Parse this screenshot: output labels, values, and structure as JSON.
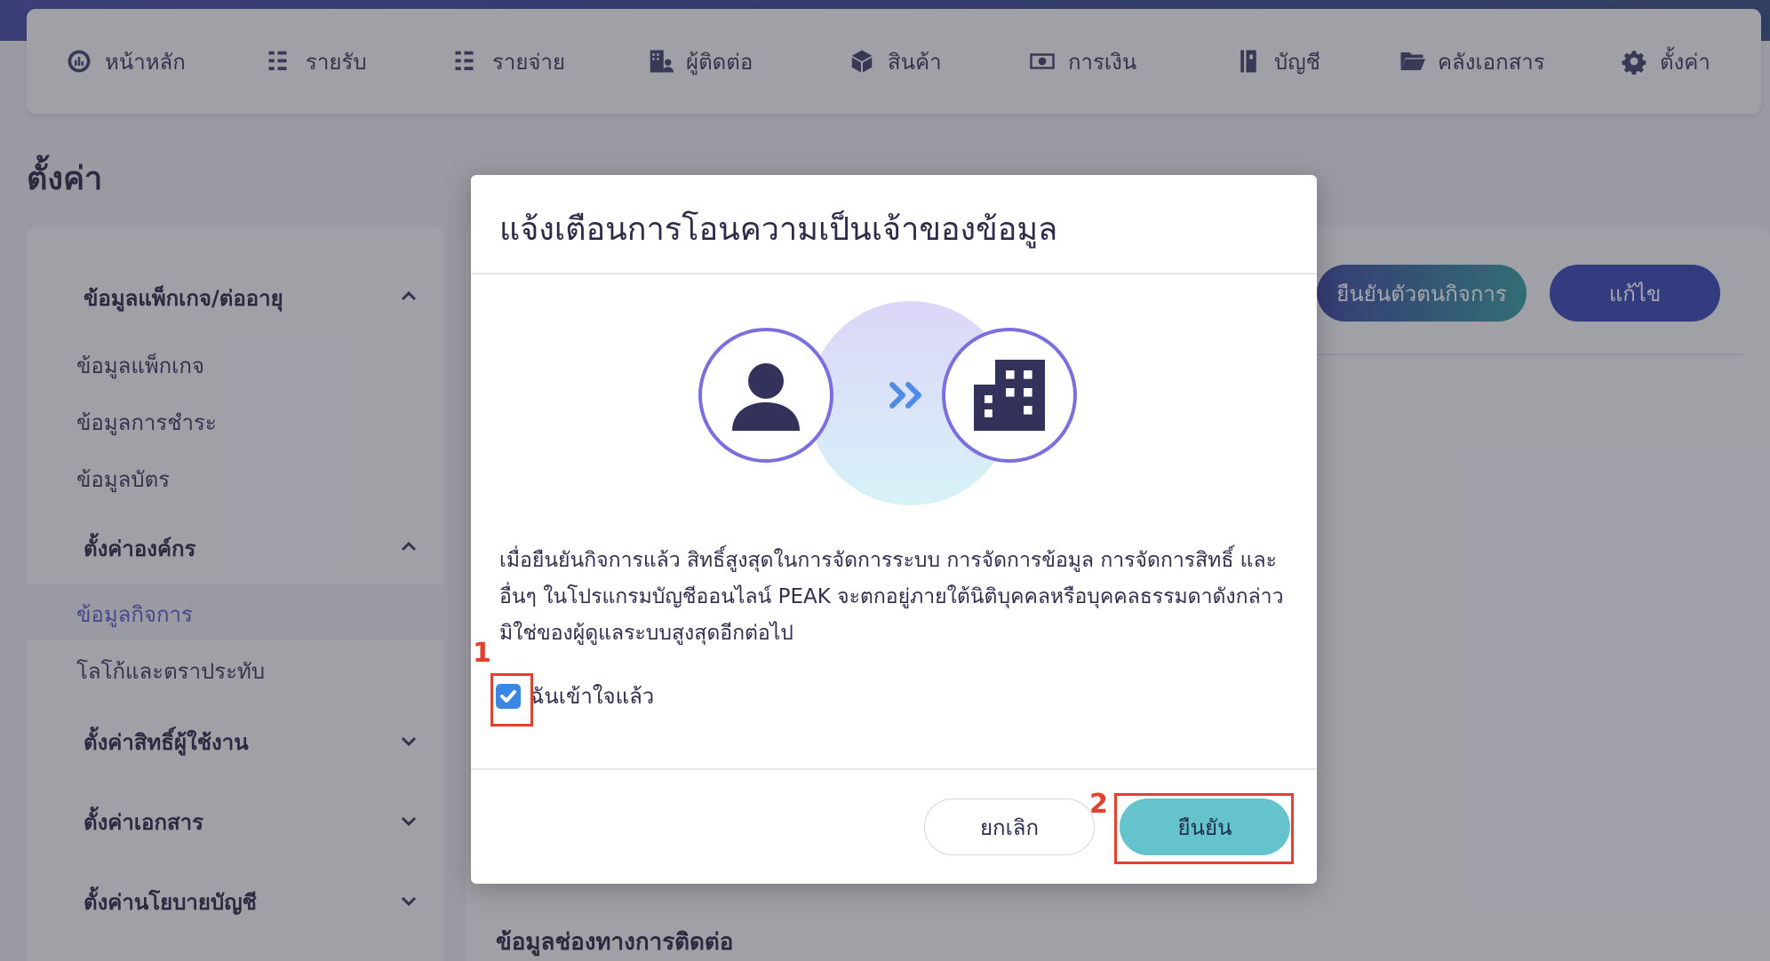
{
  "nav": {
    "items": [
      {
        "label": "หน้าหลัก",
        "icon": "dashboard-icon"
      },
      {
        "label": "รายรับ",
        "icon": "income-icon"
      },
      {
        "label": "รายจ่าย",
        "icon": "expense-icon"
      },
      {
        "label": "ผู้ติดต่อ",
        "icon": "contacts-icon"
      },
      {
        "label": "สินค้า",
        "icon": "box-icon"
      },
      {
        "label": "การเงิน",
        "icon": "money-icon"
      },
      {
        "label": "บัญชี",
        "icon": "book-icon"
      },
      {
        "label": "คลังเอกสาร",
        "icon": "folder-icon"
      },
      {
        "label": "ตั้งค่า",
        "icon": "gear-icon"
      }
    ]
  },
  "page": {
    "title": "ตั้งค่า"
  },
  "sidebar": {
    "group1": "ข้อมูลแพ็กเกจ/ต่ออายุ",
    "group1_items": [
      "ข้อมูลแพ็กเกจ",
      "ข้อมูลการชำระ",
      "ข้อมูลบัตร"
    ],
    "group2": "ตั้งค่าองค์กร",
    "group2_items": [
      "ข้อมูลกิจการ",
      "โลโก้และตราประทับ"
    ],
    "group3": "ตั้งค่าสิทธิ์ผู้ใช้งาน",
    "group4": "ตั้งค่าเอกสาร",
    "group5": "ตั้งค่านโยบายบัญชี"
  },
  "main": {
    "verify_button": "ยืนยันตัวตนกิจการ",
    "edit_button": "แก้ไข",
    "contact_section_title": "ข้อมูลช่องทางการติดต่อ"
  },
  "modal": {
    "title": "แจ้งเตือนการโอนความเป็นเจ้าของข้อมูล",
    "body_line1": "เมื่อยืนยันกิจการแล้ว สิทธิ์สูงสุดในการจัดการระบบ การจัดการข้อมูล การจัดการสิทธิ์ และ",
    "body_line2": "อื่นๆ ในโปรแกรมบัญชีออนไลน์ PEAK จะตกอยู่ภายใต้นิติบุคคลหรือบุคคลธรรมดาดังกล่าว",
    "body_line3": "มิใช่ของผู้ดูแลระบบสูงสุดอีกต่อไป",
    "checkbox_label": "ฉันเข้าใจแล้ว",
    "checkbox_checked": true,
    "cancel_button": "ยกเลิก",
    "confirm_button": "ยืนยัน"
  },
  "annotations": {
    "step1": "1",
    "step2": "2",
    "color": "#e2412e"
  }
}
